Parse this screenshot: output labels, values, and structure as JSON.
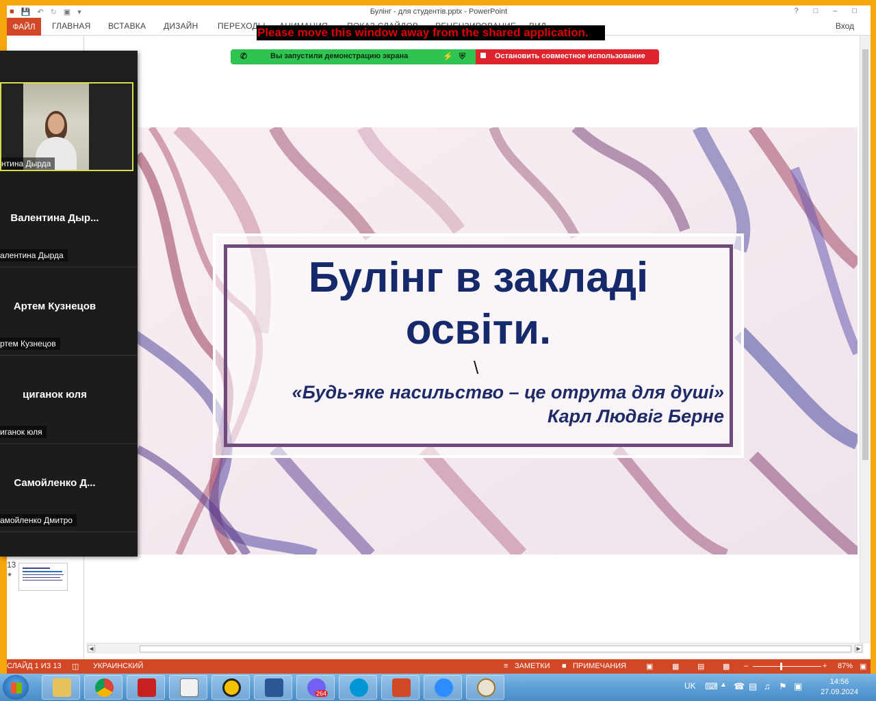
{
  "window": {
    "title": "Булінг - для студентів.pptx - PowerPoint",
    "login": "Вход"
  },
  "ribbon": {
    "file_tab": "ФАЙЛ",
    "tabs": [
      "ГЛАВНАЯ",
      "ВСТАВКА",
      "ДИЗАЙН",
      "ПЕРЕХОДЫ",
      "АНИМАЦИЯ",
      "ПОКАЗ СЛАЙДОВ",
      "РЕЦЕНЗИРОВАНИЕ",
      "ВИД"
    ]
  },
  "zoom": {
    "warning": "Please move this window away from the shared application.",
    "sharing_status": "Вы запустили демонстрацию экрана",
    "stop_share": "Остановить совместное использование",
    "share_bar_green": "#2fc450",
    "share_bar_red": "#e0242d",
    "self_view_name": "нтина Дырда",
    "participants": [
      {
        "display": "Валентина  Дыр...",
        "name": "алентина Дырда"
      },
      {
        "display": "Артем Кузнецов",
        "name": "ртем Кузнецов"
      },
      {
        "display": "циганок юля",
        "name": "иганок юля"
      },
      {
        "display": "Самойленко  Д...",
        "name": "амойленко Дмитро"
      }
    ]
  },
  "thumbnails": {
    "last_number": "13",
    "star": "★"
  },
  "slide": {
    "title_line1": "Булінг в закладі",
    "title_line2": "освіти.",
    "stray_char": "\\",
    "quote": "«Будь-яке насильство – це отрута для душі»",
    "author": "Карл Людвіг Берне",
    "title_color": "#162a6b",
    "frame_color": "#6f4a7a"
  },
  "statusbar": {
    "slide_counter": "СЛАЙД 1 ИЗ 13",
    "language": "УКРАИНСКИЙ",
    "notes": "ЗАМЕТКИ",
    "comments": "ПРИМЕЧАНИЯ",
    "zoom_level": "87%",
    "accent": "#d24726"
  },
  "taskbar": {
    "apps": [
      "explorer",
      "chrome",
      "acrobat",
      "calculator-doc",
      "archicad",
      "word",
      "viber",
      "hp",
      "powerpoint",
      "zoom",
      "paint"
    ],
    "viber_badge": "264",
    "language": "UK",
    "time": "14:56",
    "date": "27.09.2024"
  }
}
